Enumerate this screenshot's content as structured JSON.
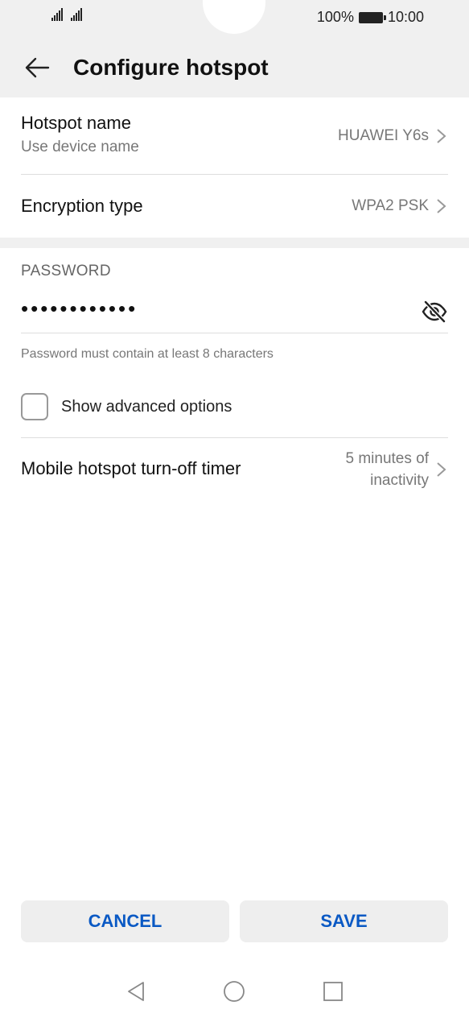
{
  "status_bar": {
    "battery": "100%",
    "time": "10:00"
  },
  "header": {
    "title": "Configure hotspot"
  },
  "settings": {
    "hotspot_name": {
      "label": "Hotspot name",
      "sublabel": "Use device name",
      "value": "HUAWEI Y6s"
    },
    "encryption": {
      "label": "Encryption type",
      "value": "WPA2 PSK"
    }
  },
  "password": {
    "section_label": "PASSWORD",
    "value": "••••••••••••",
    "hint": "Password must contain at least 8 characters"
  },
  "advanced": {
    "label": "Show advanced options",
    "checked": false
  },
  "timer": {
    "label": "Mobile hotspot turn-off timer",
    "value_line1": "5 minutes of",
    "value_line2": "inactivity"
  },
  "buttons": {
    "cancel": "CANCEL",
    "save": "SAVE"
  },
  "colors": {
    "accent": "#0a59c4",
    "header_bg": "#f0f0f0"
  },
  "icons": {
    "back": "arrow-left-icon",
    "chevron": "chevron-right-icon",
    "visibility": "eye-off-icon",
    "nav_back": "triangle-back-icon",
    "nav_home": "circle-home-icon",
    "nav_recents": "square-recents-icon"
  }
}
